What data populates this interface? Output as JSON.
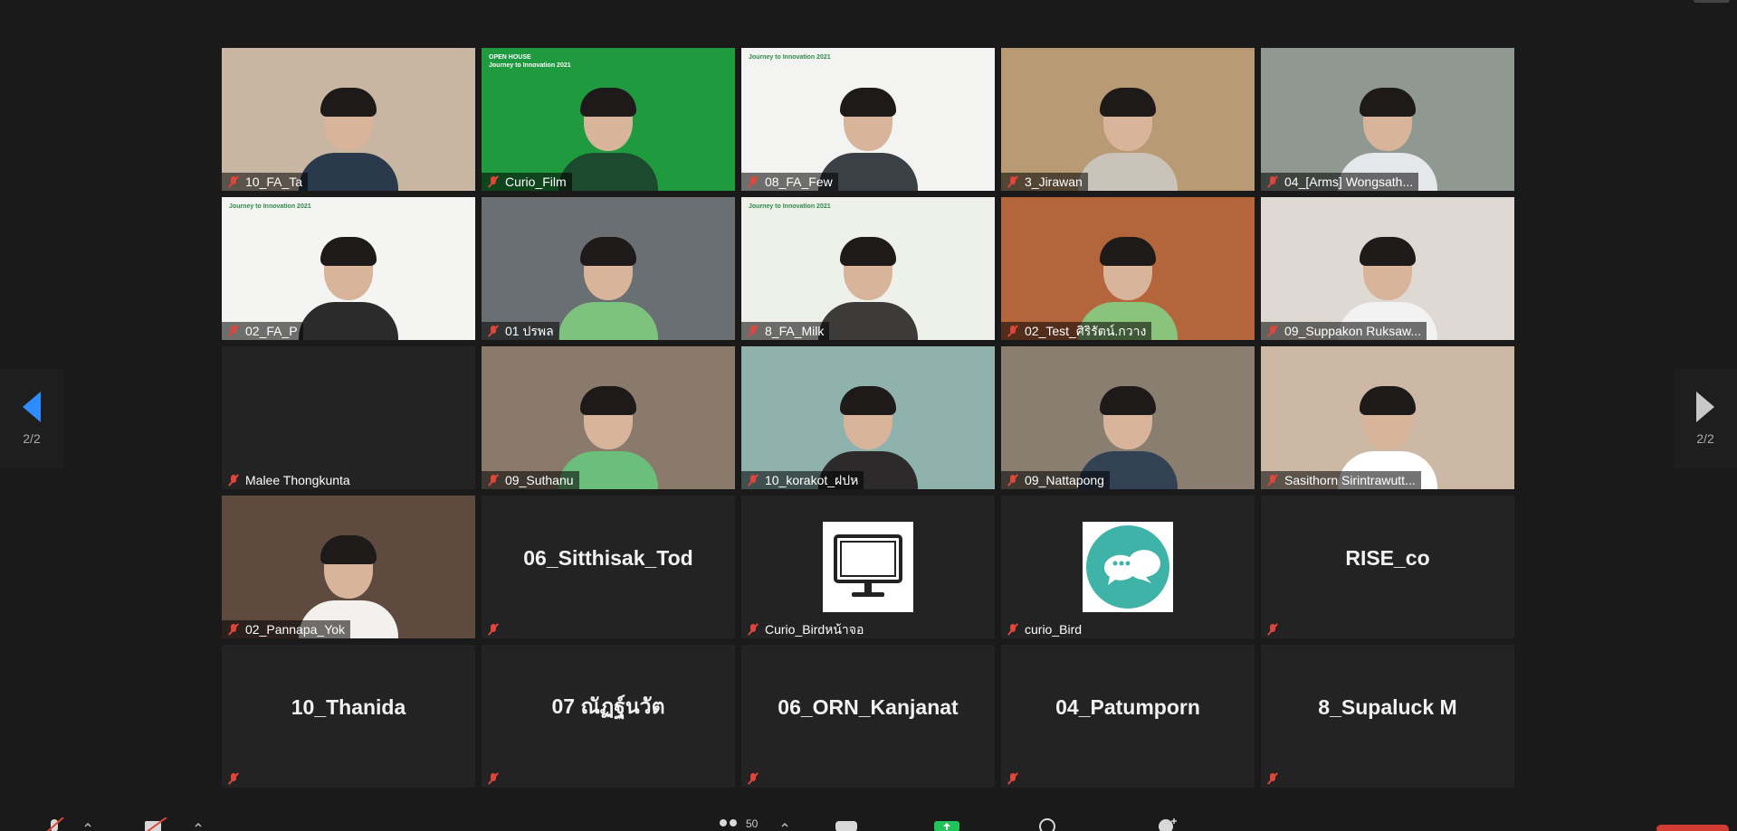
{
  "gallery": {
    "page_indicator": "2/2",
    "tiles": [
      {
        "name": "10_FA_Ta",
        "type": "video",
        "bg": "#c9b6a2",
        "shirt": "#2a3a4c"
      },
      {
        "name": "Curio_Film",
        "type": "video",
        "bg": "#1f9a3f",
        "shirt": "#1c4a2e",
        "overlay_title": "OPEN HOUSE",
        "overlay_subtitle": "Journey to Innovation 2021"
      },
      {
        "name": "08_FA_Few",
        "type": "video",
        "bg": "#f3f4f1",
        "shirt": "#3b3f46",
        "overlay_title": "Journey to Innovation 2021"
      },
      {
        "name": "3_Jirawan",
        "type": "video",
        "bg": "#b89a74",
        "shirt": "#c9c3ba"
      },
      {
        "name": "04_[Arms] Wongsath...",
        "type": "video",
        "bg": "#8f9891",
        "shirt": "#e6e7ea"
      },
      {
        "name": "02_FA_P",
        "type": "video",
        "bg": "#f4f5f2",
        "shirt": "#2b2b2b",
        "overlay_title": "Journey to Innovation 2021"
      },
      {
        "name": "01 ปรพล",
        "type": "video",
        "bg": "#6a6f74",
        "shirt": "#7ec27f"
      },
      {
        "name": "8_FA_Milk",
        "type": "video",
        "bg": "#eef0ea",
        "shirt": "#3d3a3a",
        "overlay_title": "Journey to Innovation 2021"
      },
      {
        "name": "02_Test_ศิริรัตน์.กวาง",
        "type": "video",
        "bg": "#b5653c",
        "shirt": "#8ac47c"
      },
      {
        "name": "09_Suppakon Ruksaw...",
        "type": "video",
        "bg": "#ded9d2",
        "shirt": "#f2f2f2"
      },
      {
        "name": "Malee Thongkunta",
        "type": "blank"
      },
      {
        "name": "09_Suthanu",
        "type": "video",
        "bg": "#8a7a6b",
        "shirt": "#6bbf7a"
      },
      {
        "name": "10_korakot_ฝปห",
        "type": "video",
        "bg": "#8fb2ad",
        "shirt": "#2c2a2a"
      },
      {
        "name": "09_Nattapong",
        "type": "video",
        "bg": "#8a7e70",
        "shirt": "#334154"
      },
      {
        "name": "Sasithorn Sirintrawutt...",
        "type": "video",
        "bg": "#cdb8a6",
        "shirt": "#ffffff"
      },
      {
        "name": "02_Pannapa_Yok",
        "type": "video",
        "bg": "#5e4a3e",
        "shirt": "#f3f1ee"
      },
      {
        "name": "",
        "type": "name",
        "display": "06_Sitthisak_Tod"
      },
      {
        "name": "Curio_Birdหน้าจอ",
        "type": "avatar",
        "avatar_icon": "monitor-icon"
      },
      {
        "name": "curio_Bird",
        "type": "avatar",
        "avatar_icon": "chat-bubbles-icon"
      },
      {
        "name": "",
        "type": "name",
        "display": "RISE_co"
      },
      {
        "name": "",
        "type": "name",
        "display": "10_Thanida"
      },
      {
        "name": "",
        "type": "name",
        "display": "07 ณัฏฐ์นวัต"
      },
      {
        "name": "",
        "type": "name",
        "display": "06_ORN_Kanjanat"
      },
      {
        "name": "",
        "type": "name",
        "display": "04_Patumporn"
      },
      {
        "name": "",
        "type": "name",
        "display": "8_Supaluck M"
      }
    ]
  },
  "toolbar": {
    "participants_count": "50"
  },
  "colors": {
    "background": "#1a1a1a",
    "tile": "#232323",
    "muted_icon": "#e0453b",
    "nav_active": "#2d8cff",
    "end_button": "#d23c32"
  }
}
